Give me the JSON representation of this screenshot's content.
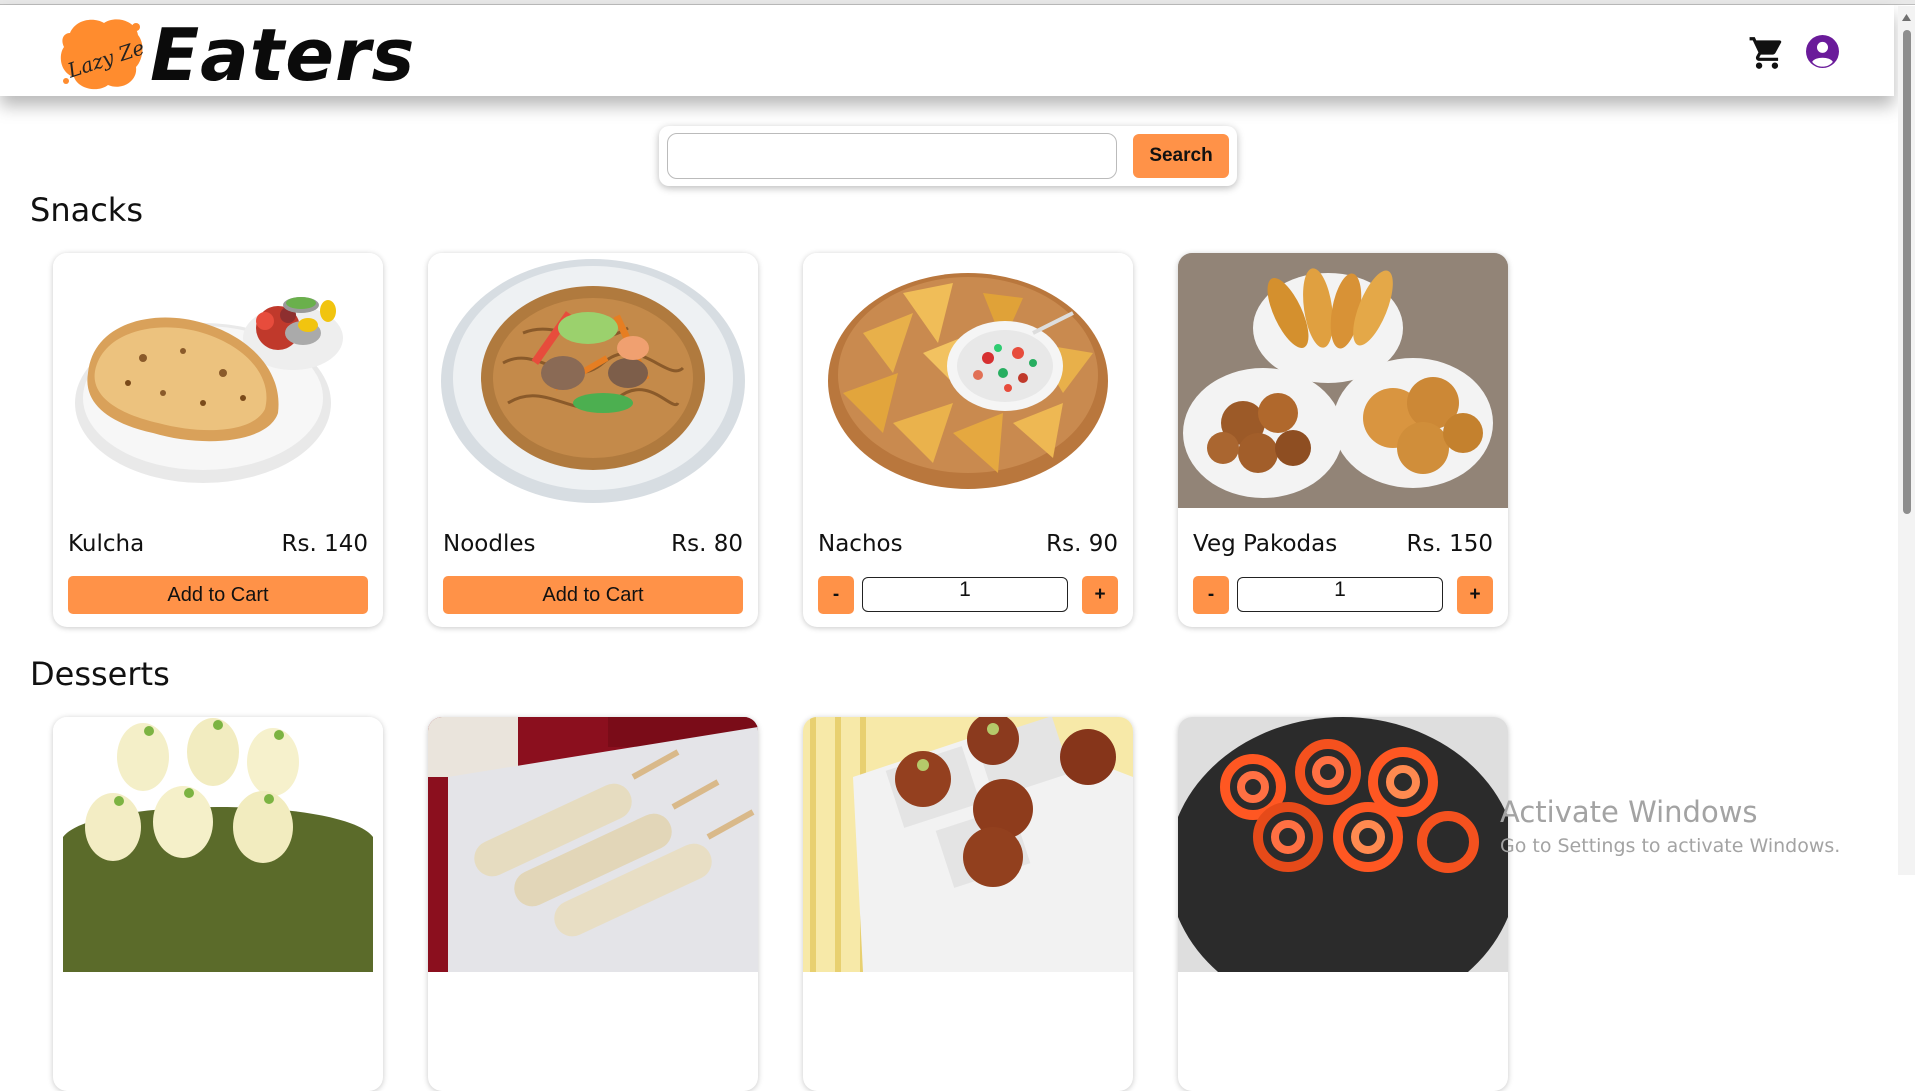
{
  "brand": {
    "logo_text": "LazyZee",
    "name": "Eaters",
    "accent_color": "#ff9248"
  },
  "header": {
    "cart_icon": "shopping-cart-icon",
    "profile_icon": "user-circle-icon"
  },
  "search": {
    "placeholder": "",
    "value": "",
    "button_label": "Search"
  },
  "sections": [
    {
      "title": "Snacks",
      "items": [
        {
          "name": "Kulcha",
          "price": "Rs. 140",
          "action": "Add to Cart"
        },
        {
          "name": "Noodles",
          "price": "Rs. 80",
          "action": "Add to Cart"
        },
        {
          "name": "Nachos",
          "price": "Rs. 90",
          "minus": "-",
          "quantity": "1",
          "plus": "+"
        },
        {
          "name": "Veg Pakodas",
          "price": "Rs. 150",
          "minus": "-",
          "quantity": "1",
          "plus": "+"
        }
      ]
    },
    {
      "title": "Desserts",
      "items": []
    }
  ],
  "watermark": {
    "title": "Activate Windows",
    "subtitle": "Go to Settings to activate Windows."
  }
}
